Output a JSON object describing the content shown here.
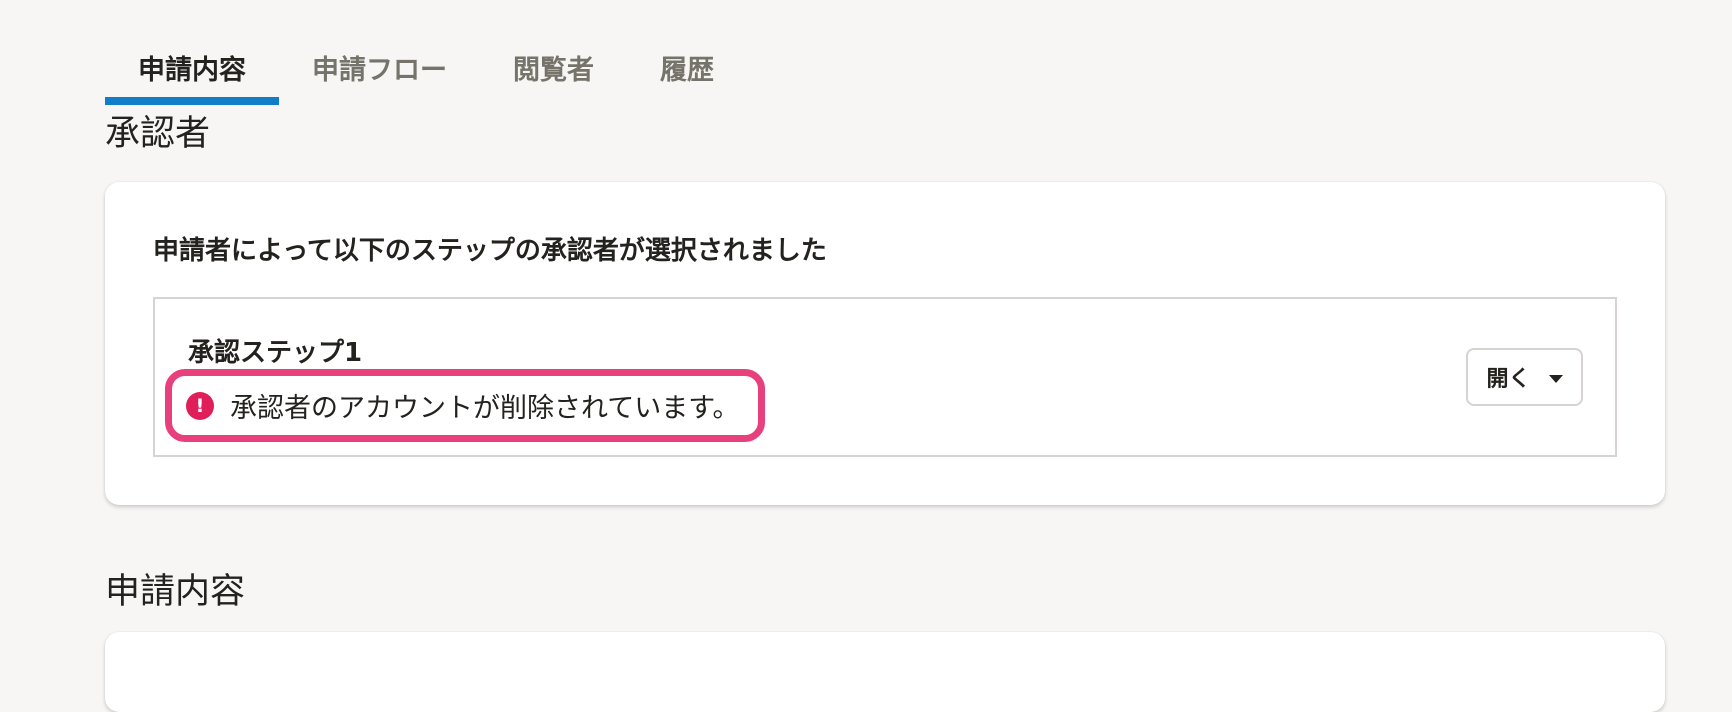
{
  "tabs": [
    {
      "label": "申請内容",
      "active": true
    },
    {
      "label": "申請フロー",
      "active": false
    },
    {
      "label": "閲覧者",
      "active": false
    },
    {
      "label": "履歴",
      "active": false
    }
  ],
  "approvers": {
    "section_title": "承認者",
    "heading": "申請者によって以下のステップの承認者が選択されました",
    "step": {
      "title": "承認ステップ1",
      "error_message": "承認者のアカウントが削除されています。",
      "open_button_label": "開く"
    }
  },
  "application_content": {
    "section_title": "申請内容"
  },
  "icons": {
    "error": "exclamation-circle-icon",
    "caret": "caret-down-icon"
  },
  "colors": {
    "active_tab_underline": "#0f7dc7",
    "highlight_border": "#e8407d",
    "error_icon": "#e01e5a"
  }
}
